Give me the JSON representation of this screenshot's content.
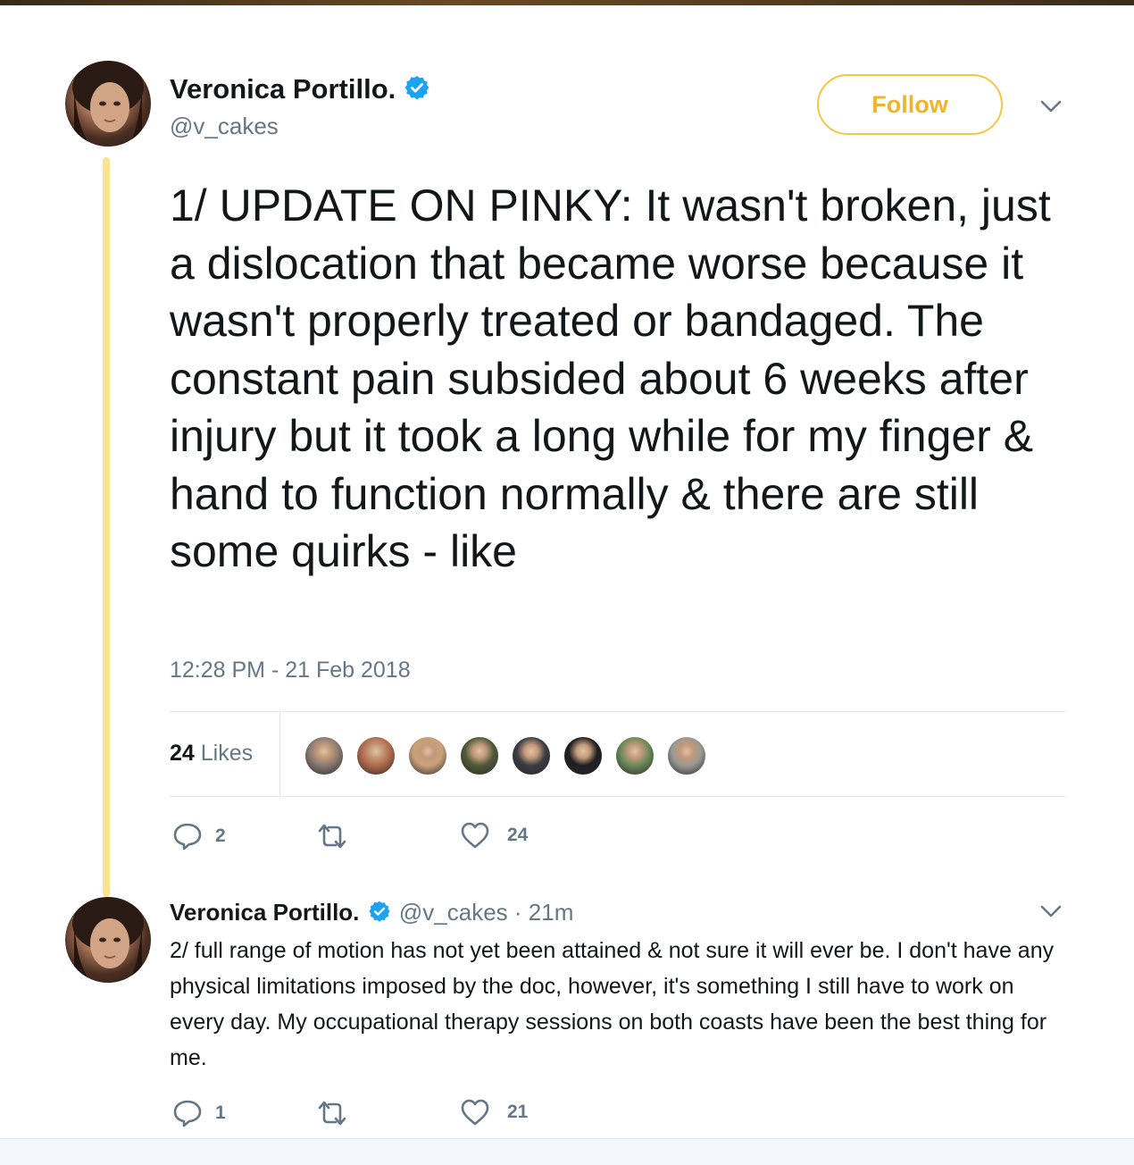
{
  "main_tweet": {
    "display_name": "Veronica Portillo.",
    "handle": "@v_cakes",
    "follow_label": "Follow",
    "text": "1/ UPDATE ON PINKY: It wasn't broken, just a dislocation that became worse because it wasn't properly treated or bandaged. The constant pain subsided about 6 weeks after injury but it took a long while for my finger & hand to function normally & there are still some quirks - like",
    "timestamp": "12:28 PM - 21 Feb 2018",
    "likes_count": "24",
    "likes_label": "Likes",
    "reply_count": "2",
    "like_count": "24",
    "likers": [
      "#8a7b73",
      "#b06a4c",
      "#c9a27a",
      "#4f5a3a",
      "#3c3c46",
      "#1e1e22",
      "#6a8a5a",
      "#9a9a94"
    ]
  },
  "reply_tweet": {
    "display_name": "Veronica Portillo.",
    "handle": "@v_cakes",
    "separator": "·",
    "time_ago": "21m",
    "text": "2/ full range of motion has not yet been attained & not sure it will ever be. I don't have any physical limitations imposed by the doc, however, it's something I still have to work on every day.  My occupational therapy sessions on both coasts have been the best thing for me.",
    "reply_count": "1",
    "like_count": "21"
  },
  "colors": {
    "follow_accent": "#f0b429",
    "thread_line": "#fbe38f",
    "verified": "#1da1f2",
    "muted": "#657786"
  }
}
